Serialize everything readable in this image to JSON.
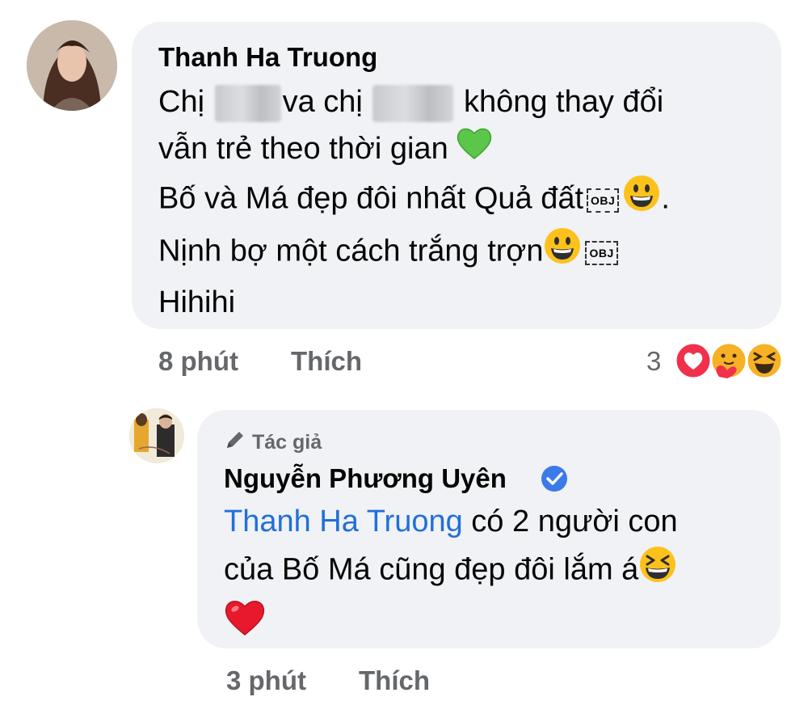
{
  "comment": {
    "author": "Thanh Ha Truong",
    "lines": {
      "l1a": "Chị ",
      "l1b": "va chị ",
      "l1c": " không thay đổi",
      "l2": "vẫn trẻ theo thời gian ",
      "l3": "Bố và Má đẹp đôi nhất Quả đất",
      "l3end": ".",
      "l4": "Nịnh bợ một cách trắng trợn",
      "l5": "Hihihi"
    },
    "obj_label": "OBJ",
    "time": "8 phút",
    "like_label": "Thích",
    "reaction_count": "3"
  },
  "reply": {
    "badge": "Tác giả",
    "author": "Nguyễn Phương Uyên",
    "mention": "Thanh Ha Truong",
    "text1": " có 2 người con",
    "text2": "của Bố Má cũng đẹp đôi lắm á",
    "time": "3 phút",
    "like_label": "Thích"
  },
  "colors": {
    "bubble": "#f0f2f5",
    "secondary_text": "#65676b",
    "link": "#216fdb",
    "verified": "#3b7ae8"
  },
  "icons": [
    "green-heart-emoji",
    "grinning-emoji",
    "laughing-emoji",
    "red-heart-emoji",
    "love-reaction-icon",
    "care-reaction-icon",
    "haha-reaction-icon",
    "pencil-icon",
    "verified-badge-icon"
  ]
}
